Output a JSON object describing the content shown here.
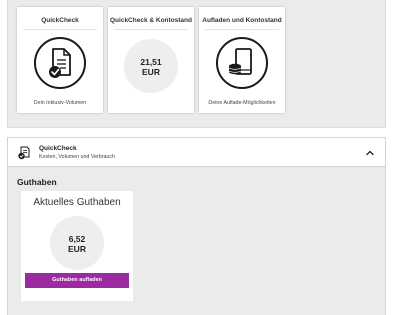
{
  "cards": [
    {
      "title": "QuickCheck",
      "footer": "Dein Inklusiv-Volumen",
      "icon": "document-check-icon"
    },
    {
      "title": "QuickCheck & Kontostand",
      "amount": "21,51",
      "currency": "EUR"
    },
    {
      "title": "Aufladen und Kontostand",
      "footer": "Deine Auflade-Möglichkeiten",
      "icon": "tablet-coins-icon"
    }
  ],
  "accordion": {
    "title": "QuickCheck",
    "subtitle": "Kosten, Volumen und Verbrauch",
    "icon": "document-check-icon",
    "toggle_icon": "chevron-up-icon"
  },
  "guthaben": {
    "section_title": "Guthaben",
    "card_title": "Aktuelles Guthaben",
    "amount": "6,52",
    "currency": "EUR",
    "button_label": "Guthaben aufladen"
  },
  "colors": {
    "accent": "#9c2aa0",
    "panel_bg": "#ebebeb"
  }
}
